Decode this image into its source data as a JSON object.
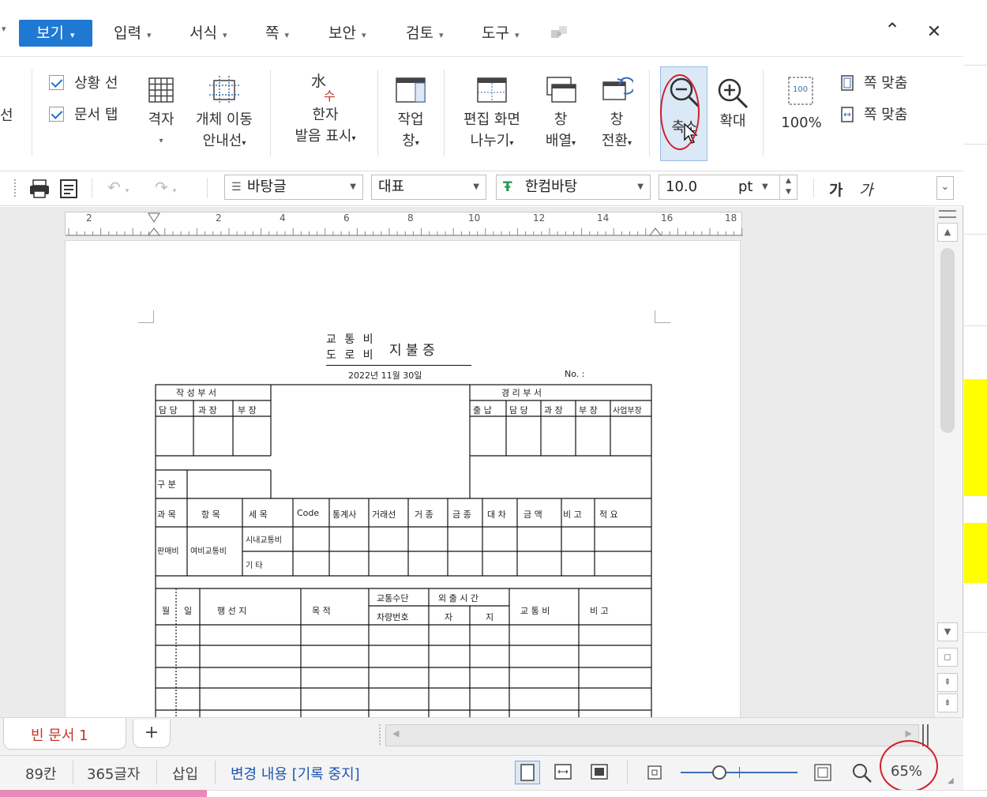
{
  "menubar": {
    "active": "보기",
    "items": [
      "입력",
      "서식",
      "쪽",
      "보안",
      "검토",
      "도구"
    ],
    "collapse": "⌃",
    "close": "✕"
  },
  "ribbon": {
    "left_partial": "선",
    "checks": [
      "상황 선",
      "문서 탭"
    ],
    "grid": "격자",
    "object_guide": [
      "개체 이동",
      "안내선"
    ],
    "hanja": [
      "한자",
      "발음 표시"
    ],
    "hanja_icon": [
      "水",
      "수"
    ],
    "work_pane": [
      "작업",
      "창"
    ],
    "split": [
      "편집 화면",
      "나누기"
    ],
    "arrange": [
      "창",
      "배열"
    ],
    "switch": [
      "창",
      "전환"
    ],
    "zoom_out": "축소",
    "zoom_in": "확대",
    "hundred": "100%",
    "hundred_icon": "100",
    "fit": [
      "쪽 맞춤",
      "쪽 맞춤"
    ]
  },
  "toolbar": {
    "style": "바탕글",
    "lang": "대표",
    "font": "한컴바탕",
    "size": "10.0",
    "unit": "pt",
    "bold": "가",
    "italic": "가"
  },
  "ruler": [
    "2",
    "2",
    "4",
    "6",
    "8",
    "10",
    "12",
    "14",
    "16",
    "18"
  ],
  "form": {
    "title_top": "교 통 비",
    "title_bottom": "도 로 비",
    "title_main": "지  불  증",
    "date": "2022년 11월 30일",
    "no": "No. :",
    "approve_left": "작  성  부  서",
    "approve_left_cells": [
      "담 당",
      "과 장",
      "부 장"
    ],
    "approve_right": "경    리    부    서",
    "approve_right_cells": [
      "출 납",
      "담 당",
      "과 장",
      "부 장",
      "사업부장"
    ],
    "dept": "구 분",
    "header_row": [
      "과 목",
      "항 목",
      "세 목",
      "Code",
      "통계사",
      "거래선",
      "거 종",
      "금 종",
      "대 차",
      "금 액",
      "적 요",
      "비 고"
    ],
    "row_main": [
      "판매비",
      "여비교통비"
    ],
    "sub_items": [
      "시내교통비",
      "기 타"
    ],
    "table2_header": [
      "월",
      "일",
      "행 선 지",
      "목 적",
      "교통수단",
      "외 출 시 간",
      "교 통 비",
      "비 고"
    ],
    "table2_sub": [
      "차량번호",
      "자",
      "지"
    ]
  },
  "tabs": {
    "doc": "빈 문서 1",
    "add": "+"
  },
  "status": {
    "cell": "89칸",
    "chars": "365글자",
    "mode": "삽입",
    "track": "변경 내용 [기록 중지]",
    "zoom": "65%"
  },
  "colors": {
    "accent": "#1f78d1",
    "highlight": "#d21f2a",
    "yellow": "#ffff00"
  }
}
